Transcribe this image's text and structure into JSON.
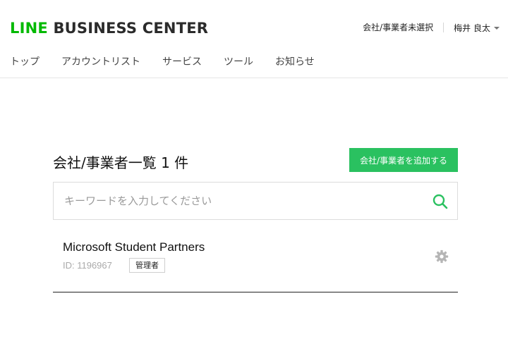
{
  "header": {
    "logo_line": "LINE",
    "logo_rest": "BUSINESS CENTER",
    "company_select": "会社/事業者未選択",
    "user_name": "梅井 良太"
  },
  "nav": {
    "items": [
      {
        "label": "トップ"
      },
      {
        "label": "アカウントリスト"
      },
      {
        "label": "サービス"
      },
      {
        "label": "ツール"
      },
      {
        "label": "お知らせ"
      }
    ]
  },
  "main": {
    "title": "会社/事業者一覧 1 件",
    "add_button": "会社/事業者を追加する",
    "search": {
      "placeholder": "キーワードを入力してください",
      "value": ""
    },
    "companies": [
      {
        "name": "Microsoft Student Partners",
        "id_text": "ID: 1196967",
        "role": "管理者"
      }
    ]
  },
  "colors": {
    "brand_green": "#00b900",
    "button_green": "#2ac160",
    "search_icon": "#2ac160",
    "gear_icon": "#b5b5b5"
  },
  "icons": {
    "search": "search-icon",
    "settings": "gear-icon",
    "dropdown": "chevron-down-icon"
  }
}
